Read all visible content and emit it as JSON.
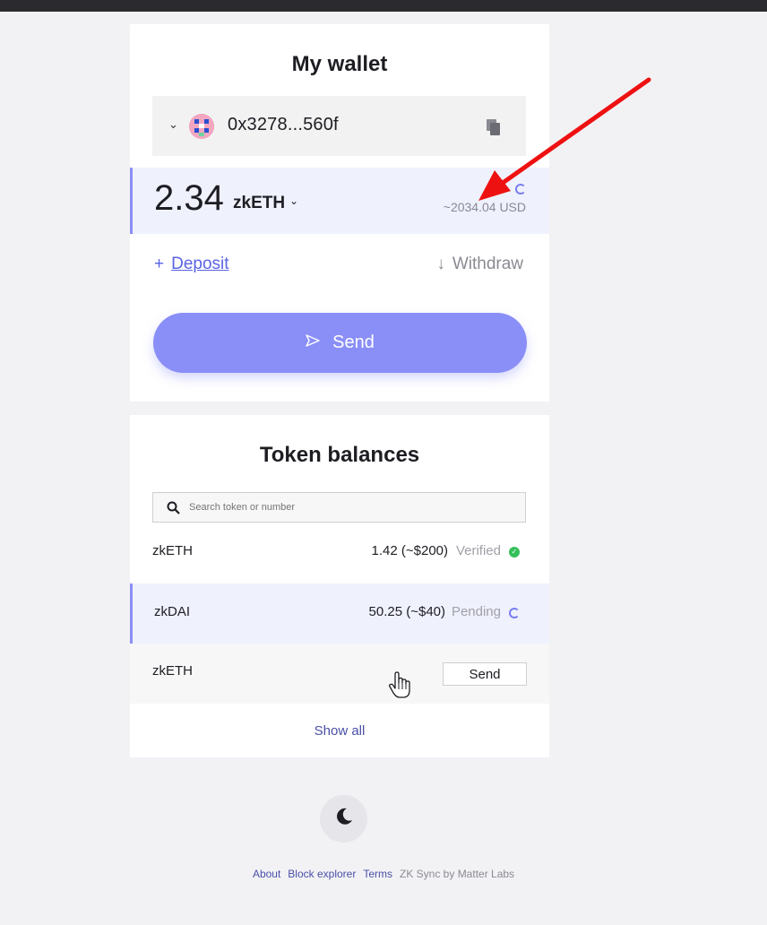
{
  "wallet": {
    "title": "My wallet",
    "address": "0x3278...560f",
    "balance_amount": "2.34",
    "balance_token": "zkETH",
    "balance_usd": "~2034.04 USD",
    "deposit_label": "Deposit",
    "withdraw_label": "Withdraw",
    "send_label": "Send"
  },
  "tokens": {
    "title": "Token balances",
    "search_placeholder": "Search token or number",
    "rows": [
      {
        "name": "zkETH",
        "value": "1.42 (~$200)",
        "status": "Verified"
      },
      {
        "name": "zkDAI",
        "value": "50.25 (~$40)",
        "status": "Pending"
      },
      {
        "name": "zkETH",
        "action": "Send"
      }
    ],
    "show_all_label": "Show all"
  },
  "footer": {
    "links": [
      "About",
      "Block explorer",
      "Terms"
    ],
    "credit": "ZK Sync by Matter Labs"
  },
  "colors": {
    "accent": "#8a8ef7",
    "verified": "#34c05a",
    "annotation_arrow": "#ee1111"
  },
  "icons": {
    "copy": "copy-icon",
    "search": "search-icon",
    "send": "send-icon",
    "moon": "moon-icon",
    "check": "check-icon"
  }
}
